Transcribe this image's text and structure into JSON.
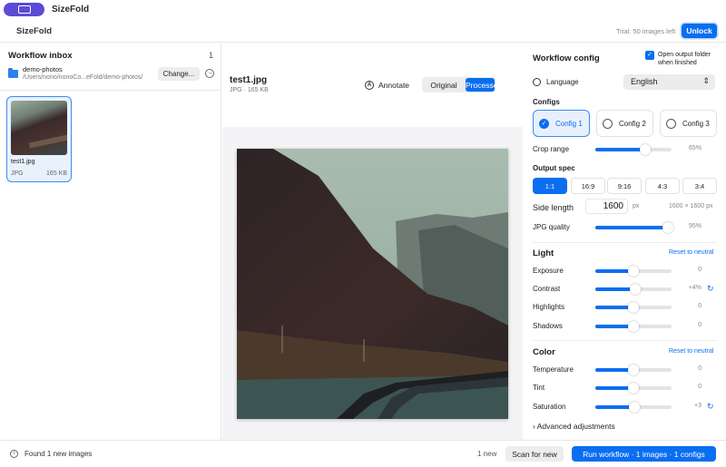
{
  "app": {
    "name": "SizeFold",
    "tab": "SizeFold",
    "trial": "Trial: 50 images left",
    "unlock": "Unlock"
  },
  "inbox": {
    "title": "Workflow inbox",
    "count": "1",
    "folder_name": "demo-photos",
    "folder_path": "/Users/nono/nonoCo...eFold/demo-photos/",
    "change": "Change...",
    "items": [
      {
        "name": "test1.jpg",
        "type": "JPG",
        "size": "165 KB"
      }
    ]
  },
  "preview": {
    "file": "test1.jpg",
    "meta": "JPG · 165 KB",
    "annotate": "Annotate",
    "original": "Original",
    "processed": "Processed"
  },
  "config": {
    "title": "Workflow config",
    "open_output": "Open output folder when finished",
    "language_label": "Language",
    "language_value": "English",
    "configs_label": "Configs",
    "configs": [
      "Config 1",
      "Config 2",
      "Config 3"
    ],
    "crop_label": "Crop range",
    "crop_value": "65%",
    "crop_level": 0.65,
    "output_spec_label": "Output spec",
    "ratios": [
      "1:1",
      "16:9",
      "9:16",
      "4:3",
      "3:4"
    ],
    "side_label": "Side length",
    "side_value": "1600",
    "side_unit": "px",
    "dims": "1600 × 1600 px",
    "jpg_label": "JPG quality",
    "jpg_value": "95%",
    "jpg_level": 0.95
  },
  "light": {
    "title": "Light",
    "reset": "Reset to neutral",
    "rows": [
      {
        "label": "Exposure",
        "value": "0",
        "level": 0.5
      },
      {
        "label": "Contrast",
        "value": "+4%",
        "level": 0.52
      },
      {
        "label": "Highlights",
        "value": "0",
        "level": 0.5
      },
      {
        "label": "Shadows",
        "value": "0",
        "level": 0.5
      }
    ]
  },
  "color": {
    "title": "Color",
    "reset": "Reset to neutral",
    "rows": [
      {
        "label": "Temperature",
        "value": "0",
        "level": 0.5
      },
      {
        "label": "Tint",
        "value": "0",
        "level": 0.5
      },
      {
        "label": "Saturation",
        "value": "+3",
        "level": 0.51
      }
    ]
  },
  "advanced": "Advanced adjustments",
  "footer": {
    "found": "Found 1 new images",
    "new_count": "1 new",
    "scan": "Scan for new",
    "run": "Run workflow · 1 images · 1 configs"
  },
  "colors": {
    "accent": "#0a6ef0",
    "brand": "#5b4bd6"
  }
}
